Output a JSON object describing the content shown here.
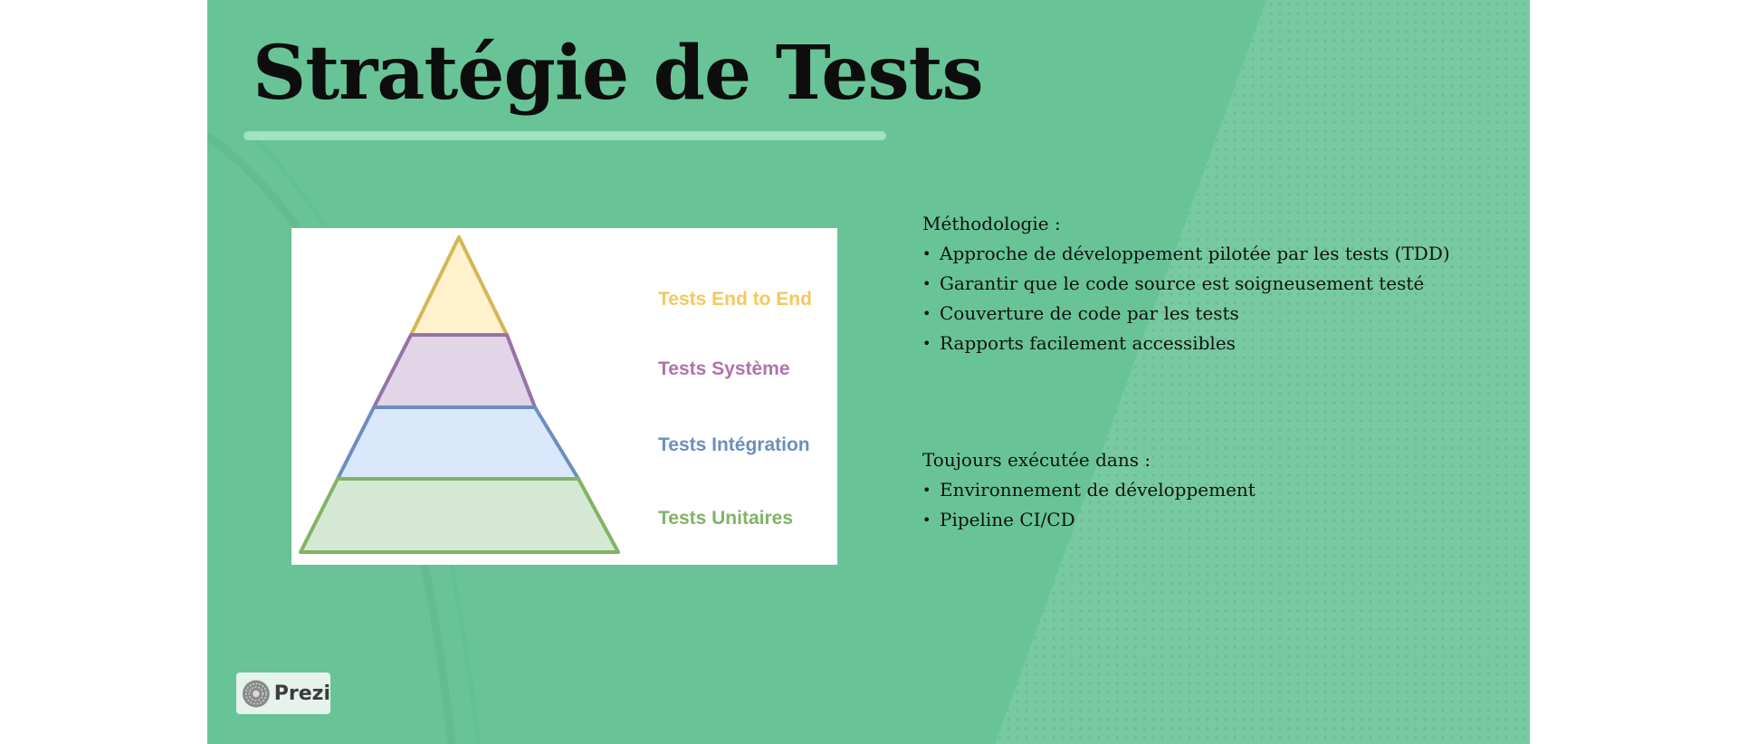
{
  "slide": {
    "title": "Stratégie de Tests"
  },
  "pyramid": {
    "layers": [
      {
        "label": "Tests End to End",
        "color": "#f5c85a",
        "fill": "#fff2cc",
        "stroke": "#d6b656"
      },
      {
        "label": "Tests Système",
        "color": "#b272ab",
        "fill": "#e1d5e7",
        "stroke": "#9673a6"
      },
      {
        "label": "Tests Intégration",
        "color": "#6c8ebf",
        "fill": "#dae8fc",
        "stroke": "#6c8ebf"
      },
      {
        "label": "Tests Unitaires",
        "color": "#82b366",
        "fill": "#d5e8d4",
        "stroke": "#82b366"
      }
    ]
  },
  "methodology": {
    "heading": "Méthodologie :",
    "items": [
      "Approche de développement pilotée par les tests (TDD)",
      "Garantir que le code source est soigneusement testé",
      "Couverture de code par les tests",
      "Rapports facilement accessibles"
    ]
  },
  "execution": {
    "heading": "Toujours exécutée dans :",
    "items": [
      "Environnement de développement",
      "Pipeline CI/CD"
    ]
  },
  "branding": {
    "label": "Prezi",
    "icon": "prezi-logo-icon"
  },
  "colors": {
    "slide_background": "#68c497",
    "title_rule": "#9fe2c4",
    "title_text": "#0d0d0d"
  }
}
